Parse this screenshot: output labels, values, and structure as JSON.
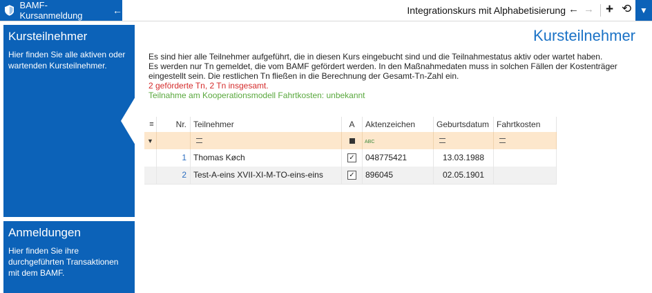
{
  "app": {
    "title": "BAMF-Kursanmeldung",
    "context_title": "Integrationskurs mit Alphabetisierung"
  },
  "panels": {
    "participants": {
      "title": "Kursteilnehmer",
      "text": "Hier finden Sie alle aktiven oder wartenden Kursteilnehmer."
    },
    "registrations": {
      "title": "Anmeldungen",
      "text": "Hier finden Sie ihre durchgeführten Transaktionen mit dem BAMF."
    }
  },
  "main": {
    "heading": "Kursteilnehmer",
    "description_line1": "Es sind hier alle Teilnehmer aufgeführt, die in diesen Kurs eingebucht sind und die Teilnahmestatus aktiv oder wartet haben.",
    "description_line2": "Es werden nur Tn gemeldet, die vom BAMF gefördert werden. In den Maßnahmedaten muss in solchen Fällen der Kostenträger eingestellt sein. Die restlichen Tn fließen in die Berechnung der Gesamt-Tn-Zahl ein.",
    "count_text": "2 geförderte Tn,  2 Tn insgesamt.",
    "coop_text": "Teilnahme am Kooperationsmodell Fahrtkosten: unbekannt"
  },
  "grid": {
    "columns": [
      "Nr.",
      "Teilnehmer",
      "A",
      "Aktenzeichen",
      "Geburtsdatum",
      "Fahrtkosten"
    ],
    "rows": [
      {
        "nr": "1",
        "name": "Thomas Køch",
        "checked": true,
        "aktenzeichen": "048775421",
        "geburtsdatum": "13.03.1988",
        "fahrtkosten": ""
      },
      {
        "nr": "2",
        "name": "Test-A-eins XVII-XI-M-TO-eins-eins",
        "checked": true,
        "aktenzeichen": "896045",
        "geburtsdatum": "02.05.1901",
        "fahrtkosten": ""
      }
    ]
  },
  "icons": {
    "accent": "#0c62b8",
    "heading_color": "#1a72c6",
    "filter_row_bg": "#fde7cc"
  }
}
